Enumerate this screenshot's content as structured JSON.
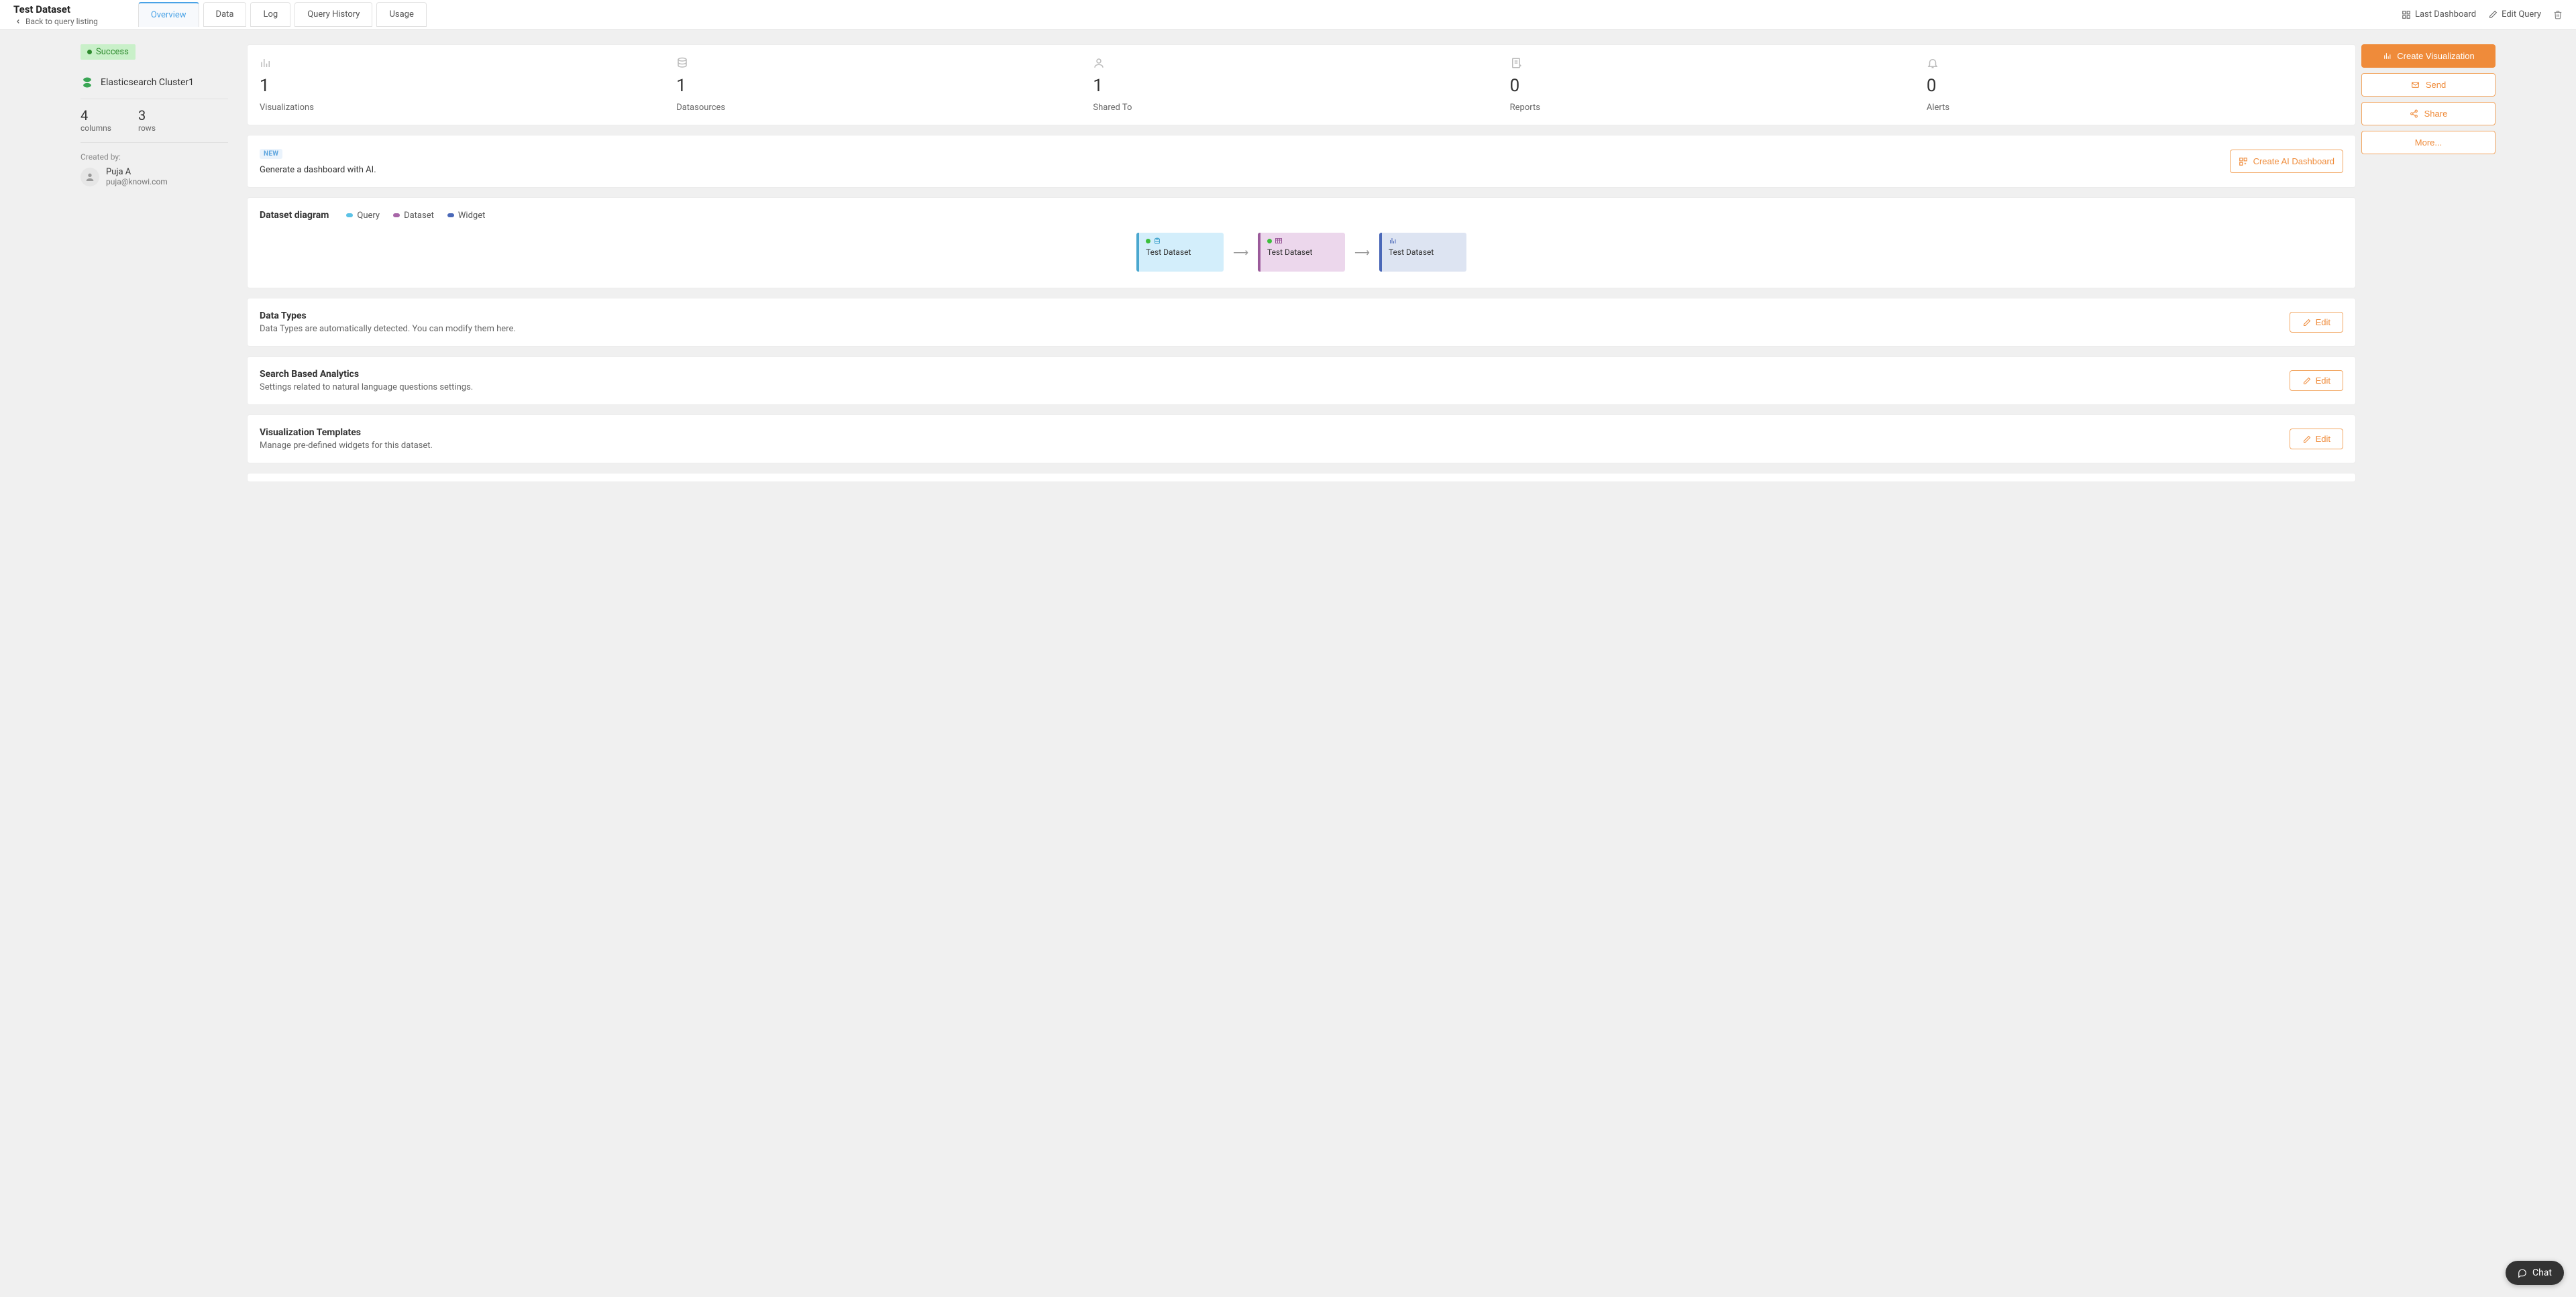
{
  "header": {
    "title": "Test Dataset",
    "back_label": "Back to query listing",
    "tabs": [
      "Overview",
      "Data",
      "Log",
      "Query History",
      "Usage"
    ],
    "active_tab": 0,
    "last_dashboard": "Last Dashboard",
    "edit_query": "Edit Query"
  },
  "sidebar": {
    "status": "Success",
    "datasource": "Elasticsearch Cluster1",
    "columns": {
      "value": "4",
      "label": "columns"
    },
    "rows": {
      "value": "3",
      "label": "rows"
    },
    "created_by_caption": "Created by:",
    "user": {
      "name": "Puja A",
      "email": "puja@knowi.com"
    }
  },
  "stats": [
    {
      "value": "1",
      "label": "Visualizations",
      "icon": "chart"
    },
    {
      "value": "1",
      "label": "Datasources",
      "icon": "db"
    },
    {
      "value": "1",
      "label": "Shared To",
      "icon": "user"
    },
    {
      "value": "0",
      "label": "Reports",
      "icon": "report"
    },
    {
      "value": "0",
      "label": "Alerts",
      "icon": "bell"
    }
  ],
  "actions": {
    "create_viz": "Create Visualization",
    "send": "Send",
    "share": "Share",
    "more": "More..."
  },
  "ai": {
    "new_badge": "NEW",
    "text": "Generate a dashboard with AI.",
    "button": "Create AI Dashboard"
  },
  "diagram": {
    "title": "Dataset diagram",
    "legend": {
      "query": "Query",
      "dataset": "Dataset",
      "widget": "Widget"
    },
    "nodes": [
      {
        "type": "query",
        "label": "Test Dataset"
      },
      {
        "type": "dataset",
        "label": "Test Dataset"
      },
      {
        "type": "widget",
        "label": "Test Dataset"
      }
    ]
  },
  "sections": {
    "data_types": {
      "title": "Data Types",
      "desc": "Data Types are automatically detected. You can modify them here.",
      "edit": "Edit"
    },
    "search_analytics": {
      "title": "Search Based Analytics",
      "desc": "Settings related to natural language questions settings.",
      "edit": "Edit"
    },
    "viz_templates": {
      "title": "Visualization Templates",
      "desc": "Manage pre-defined widgets for this dataset.",
      "edit": "Edit"
    }
  },
  "chat": {
    "label": "Chat"
  }
}
